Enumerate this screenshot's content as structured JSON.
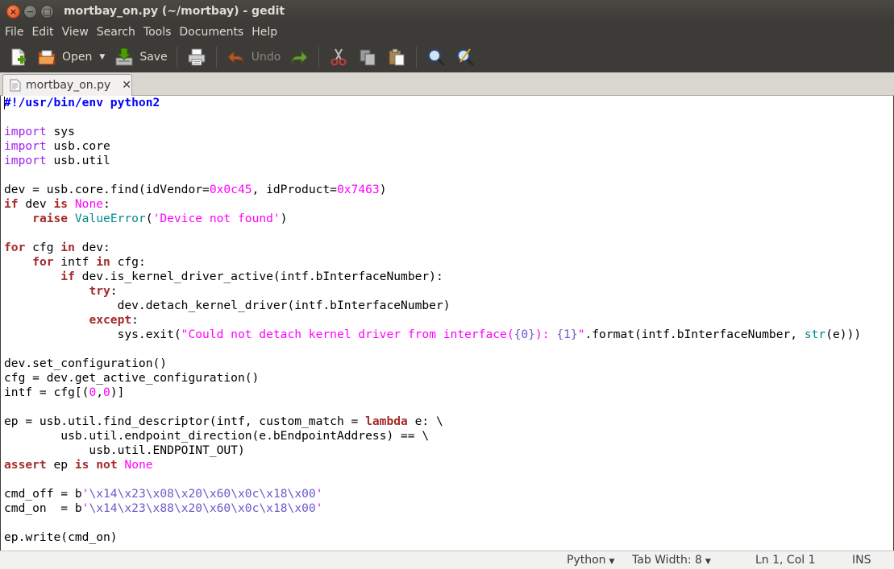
{
  "window": {
    "title": "mortbay_on.py (~/mortbay) - gedit"
  },
  "menu": [
    "File",
    "Edit",
    "View",
    "Search",
    "Tools",
    "Documents",
    "Help"
  ],
  "toolbar": {
    "open_label": "Open",
    "save_label": "Save",
    "undo_label": "Undo",
    "icons": [
      "new-document-icon",
      "open-icon",
      "save-icon",
      "print-icon",
      "undo-icon",
      "redo-icon",
      "cut-icon",
      "copy-icon",
      "paste-icon",
      "find-icon",
      "replace-icon"
    ]
  },
  "tab": {
    "label": "mortbay_on.py",
    "close": "✕"
  },
  "code": {
    "language": "Python",
    "lines": [
      "#!/usr/bin/env python2",
      "",
      "import sys",
      "import usb.core",
      "import usb.util",
      "",
      "dev = usb.core.find(idVendor=0x0c45, idProduct=0x7463)",
      "if dev is None:",
      "    raise ValueError('Device not found')",
      "",
      "for cfg in dev:",
      "    for intf in cfg:",
      "        if dev.is_kernel_driver_active(intf.bInterfaceNumber):",
      "            try:",
      "                dev.detach_kernel_driver(intf.bInterfaceNumber)",
      "            except:",
      "                sys.exit(\"Could not detach kernel driver from interface({0}): {1}\".format(intf.bInterfaceNumber, str(e)))",
      "",
      "dev.set_configuration()",
      "cfg = dev.get_active_configuration()",
      "intf = cfg[(0,0)]",
      "",
      "ep = usb.util.find_descriptor(intf, custom_match = lambda e: \\",
      "        usb.util.endpoint_direction(e.bEndpointAddress) == \\",
      "            usb.util.ENDPOINT_OUT)",
      "assert ep is not None",
      "",
      "cmd_off = b'\\x14\\x23\\x08\\x20\\x60\\x0c\\x18\\x00'",
      "cmd_on  = b'\\x14\\x23\\x88\\x20\\x60\\x0c\\x18\\x00'",
      "",
      "ep.write(cmd_on)"
    ]
  },
  "status": {
    "language": "Python",
    "tab_width": "Tab Width: 8",
    "position": "Ln 1, Col 1",
    "mode": "INS"
  },
  "colors": {
    "keyword": "#a52a2a",
    "preproc": "#a020f0",
    "string": "#ff00ff",
    "escape": "#6a5acd",
    "shebang": "#0000ff",
    "builtin": "#008b8b"
  }
}
